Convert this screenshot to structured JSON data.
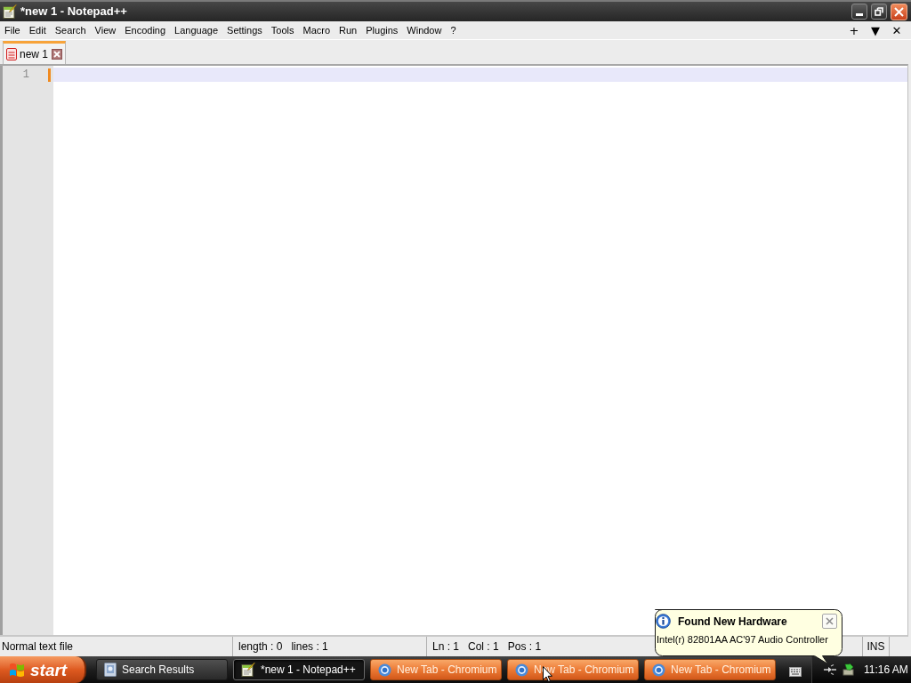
{
  "window": {
    "title": "*new 1 - Notepad++"
  },
  "menu_bar": {
    "items": [
      "File",
      "Edit",
      "Search",
      "View",
      "Encoding",
      "Language",
      "Settings",
      "Tools",
      "Macro",
      "Run",
      "Plugins",
      "Window",
      "?"
    ],
    "right_buttons": [
      "+",
      "▼",
      "✕"
    ]
  },
  "tabs": [
    {
      "label": "new 1",
      "selected": true,
      "modified": true
    }
  ],
  "editor": {
    "line_numbers": [
      "1"
    ]
  },
  "status_bar": {
    "document_type": "Normal text file",
    "length": "length : 0",
    "lines": "lines : 1",
    "line": "Ln : 1",
    "column": "Col : 1",
    "position": "Pos : 1",
    "typing_mode": "INS"
  },
  "taskbar": {
    "start_label": "start",
    "buttons": [
      {
        "label": "Search Results",
        "kind": "search",
        "selected": false,
        "flashing": false
      },
      {
        "label": "*new 1 - Notepad++",
        "kind": "notepad",
        "selected": true,
        "flashing": false
      },
      {
        "label": "New Tab - Chromium",
        "kind": "chromium",
        "selected": false,
        "flashing": true
      },
      {
        "label": "New Tab - Chromium",
        "kind": "chromium",
        "selected": false,
        "flashing": true
      },
      {
        "label": "New Tab - Chromium",
        "kind": "chromium",
        "selected": false,
        "flashing": true
      }
    ],
    "clock": "11:16 AM"
  },
  "notification": {
    "title": "Found New Hardware",
    "message": "Intel(r) 82801AA AC'97 Audio Controller"
  }
}
